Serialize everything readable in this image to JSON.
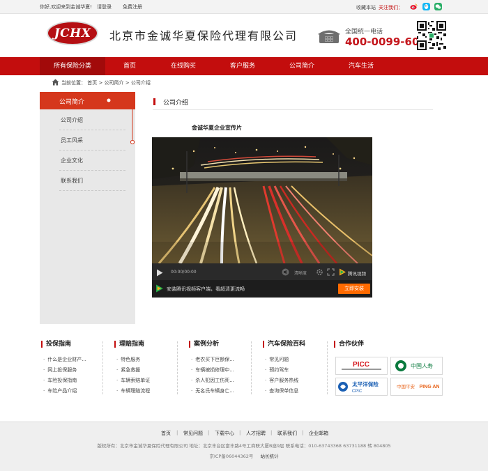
{
  "topbar": {
    "welcome": "你好,欢迎来到金诚华夏!",
    "login": "请登录",
    "register": "免费注册",
    "favorite": "收藏本站",
    "follow": "关注我们：",
    "social_icons": [
      "weibo-icon",
      "qq-icon",
      "wechat-icon"
    ]
  },
  "header": {
    "logo_text": "JCHX",
    "company_name": "北京市金诚华夏保险代理有限公司",
    "hotline_label": "全国统一电话",
    "hotline": "400-0099-600"
  },
  "nav": [
    "所有保险分类",
    "首页",
    "在线购买",
    "客户服务",
    "公司简介",
    "汽车生活"
  ],
  "breadcrumb": "当前位置： 首页 > 公司简介 > 公司介绍",
  "sidebar": {
    "active": "公司简介",
    "items": [
      "公司介绍",
      "员工风采",
      "企业文化",
      "联系我们"
    ]
  },
  "content": {
    "title": "公司介绍",
    "video_caption": "金诚华夏企业宣传片",
    "time": "00:00/00:00",
    "quality": "清晰度",
    "tv_brand": "腾讯视频",
    "promo_text": "安装腾讯视频客户端，看超清更流畅",
    "install_button": "立即安装"
  },
  "footer_columns": [
    {
      "title": "投保指南",
      "links": [
        "什么是企业财产...",
        "网上投保服务",
        "车险投保指南",
        "车险产品介绍"
      ]
    },
    {
      "title": "理赔指南",
      "links": [
        "特色服务",
        "紧急救援",
        "车辆索赔单证",
        "车辆理赔流程"
      ]
    },
    {
      "title": "案例分析",
      "links": [
        "老农买下巨额保...",
        "车辆被损修理中...",
        "杀人犯因工伤死...",
        "无名氏车辆身亡..."
      ]
    },
    {
      "title": "汽车保险百科",
      "links": [
        "常见问题",
        "预约驾车",
        "客户服务热线",
        "查询保单信息"
      ]
    },
    {
      "title": "合作伙伴",
      "partners": [
        "PICC",
        "中国人寿",
        "太平洋保险 CPIC",
        "中国平安 PINGAN"
      ]
    }
  ],
  "footer": {
    "links": [
      "首页",
      "常见问题",
      "下载中心",
      "人才招聘",
      "联系我们",
      "企业邮箱"
    ],
    "copyright": "版权所有：北京市金诚华夏保险代理有限公司 地址：北京丰台区富丰路4号工商联大厦B座9层 联系电话：010-63743368 63731188 转 804805",
    "icp": "京ICP备06044362号",
    "stats": "站长统计"
  },
  "colors": {
    "brand_red": "#c30d0d",
    "active_side": "#d5371c",
    "install_orange": "#ff6a00",
    "hotline_red": "#c4161c"
  }
}
